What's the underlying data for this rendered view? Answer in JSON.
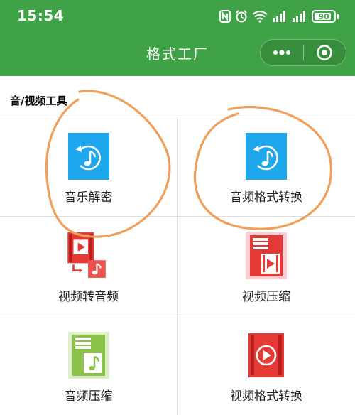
{
  "status_bar": {
    "time": "15:54",
    "battery": "90",
    "battery_level": 0.9,
    "icons": [
      "nfc-icon",
      "alarm-icon",
      "wifi-icon",
      "signal-icon",
      "signal-icon",
      "battery-icon"
    ]
  },
  "header": {
    "title": "格式工厂",
    "background": "#3fa246",
    "menu_icon": "more-dots-icon",
    "close_icon": "target-circle-icon"
  },
  "section": {
    "title": "音/视频工具"
  },
  "tools": [
    {
      "label": "音乐解密",
      "icon": "music-restore-icon"
    },
    {
      "label": "音频格式转换",
      "icon": "music-restore-icon"
    },
    {
      "label": "视频转音频",
      "icon": "video-to-audio-icon"
    },
    {
      "label": "视频压缩",
      "icon": "video-compress-icon"
    },
    {
      "label": "音频压缩",
      "icon": "audio-compress-icon"
    },
    {
      "label": "视频格式转换",
      "icon": "video-format-icon"
    }
  ],
  "colors": {
    "audio_blue": "#1ea7ec",
    "video_red": "#e53935",
    "audio_green": "#8bc34a",
    "annotation_orange": "#f0a05a"
  }
}
